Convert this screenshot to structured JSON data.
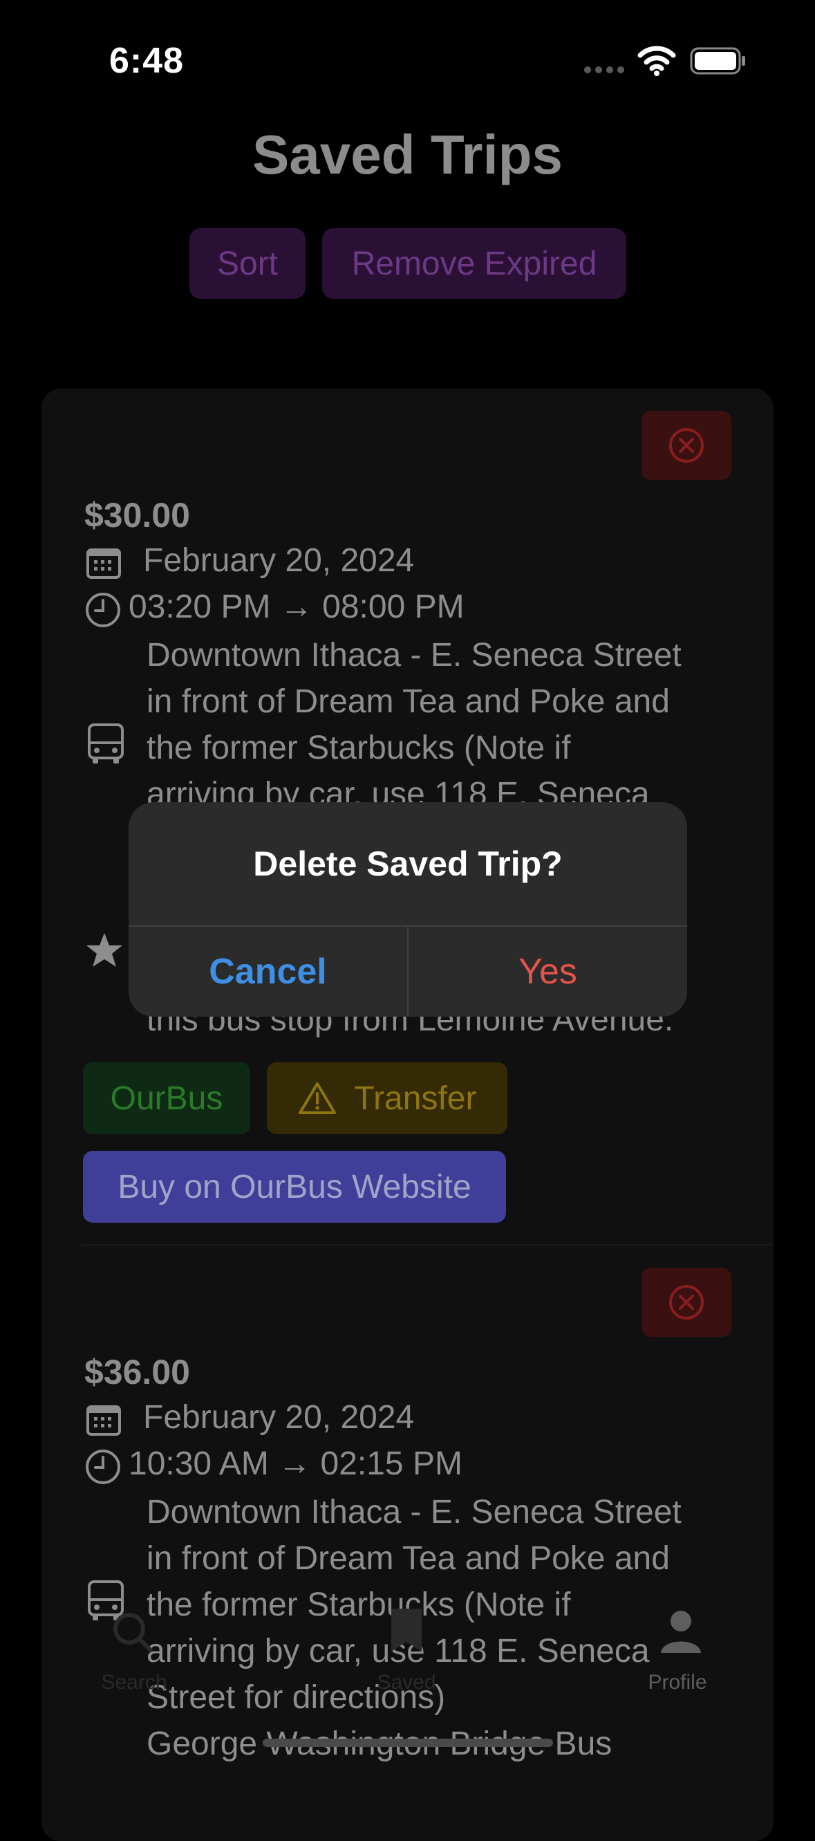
{
  "status_bar": {
    "time": "6:48"
  },
  "page": {
    "title": "Saved Trips",
    "sort_label": "Sort",
    "remove_expired_label": "Remove Expired"
  },
  "trips": [
    {
      "price": "$30.00",
      "date": "February 20, 2024",
      "time_from": "03:20 PM",
      "time_to": "08:00 PM",
      "origin_lines": [
        "Downtown Ithaca - E. Seneca Street",
        "in front of Dream Tea and Poke and",
        "the former Starbucks   (Note if",
        "arriving by car, use 118 E. Seneca"
      ],
      "destination_tail": "this bus stop from Lemoine Avenue.",
      "operator_badge": "OurBus",
      "transfer_badge": "Transfer",
      "buy_label": "Buy on OurBus Website"
    },
    {
      "price": "$36.00",
      "date": "February 20, 2024",
      "time_from": "10:30 AM",
      "time_to": "02:15 PM",
      "origin_lines": [
        "Downtown Ithaca - E. Seneca Street",
        "in front of Dream Tea and Poke and",
        "the former Starbucks   (Note if",
        "arriving by car, use 118 E. Seneca",
        "Street for directions)",
        "George Washington Bridge Bus"
      ]
    }
  ],
  "tab_bar": {
    "search": "Search",
    "saved": "Saved",
    "profile": "Profile"
  },
  "alert": {
    "title": "Delete Saved Trip?",
    "cancel": "Cancel",
    "confirm": "Yes"
  },
  "colors": {
    "accent_blue": "#3e8fe6",
    "destructive_red": "#e5534b",
    "buy_button": "#3f3f9a"
  },
  "icons": [
    "calendar-icon",
    "clock-icon",
    "bus-icon",
    "star-icon",
    "warning-icon",
    "close-circle-icon",
    "search-icon",
    "bookmark-icon",
    "profile-icon",
    "wifi-icon",
    "battery-icon"
  ]
}
